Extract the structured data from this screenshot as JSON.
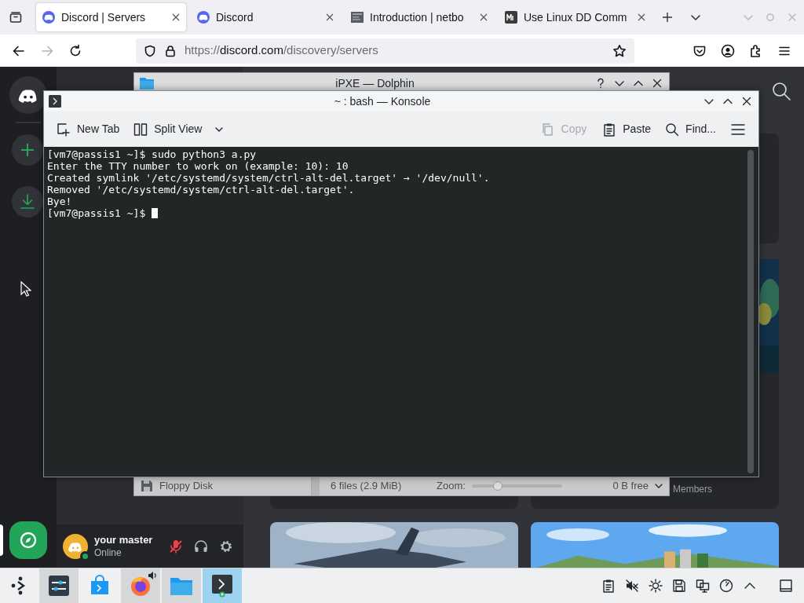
{
  "browser": {
    "tabs": [
      {
        "title": "Discord | Servers",
        "kind": "discord",
        "selected": true
      },
      {
        "title": "Discord",
        "kind": "discord",
        "selected": false
      },
      {
        "title": "Introduction | netbo",
        "kind": "page",
        "selected": false
      },
      {
        "title": "Use Linux DD Comm",
        "kind": "letter",
        "selected": false
      }
    ],
    "nav_buttons": [
      {
        "kind": "back",
        "disabled": false
      },
      {
        "kind": "forward",
        "disabled": true
      },
      {
        "kind": "reload",
        "disabled": false
      }
    ],
    "url": {
      "scheme": "https://",
      "domain": "discord.com",
      "path": "/discovery/servers"
    }
  },
  "discord": {
    "rail": [
      {
        "kind": "home",
        "selected": false
      },
      {
        "kind": "add",
        "selected": false
      },
      {
        "kind": "download",
        "selected": false
      },
      {
        "kind": "explore",
        "selected": true
      }
    ],
    "members_label": "Members",
    "user": {
      "name": "your master",
      "status": "Online",
      "mic_muted": true
    }
  },
  "dolphin": {
    "title": "iPXE — Dolphin",
    "place": "Floppy Disk",
    "file_summary": "6 files (2.9 MiB)",
    "zoom_label": "Zoom:",
    "zoom": {
      "level": 0.29
    },
    "free_space": "0 B free"
  },
  "konsole": {
    "title": "~ : bash — Konsole",
    "toolbar": [
      {
        "kind": "new-tab",
        "label": "New Tab",
        "disabled": false
      },
      {
        "kind": "split-view",
        "label": "Split View",
        "disabled": false
      },
      {
        "kind": "copy",
        "label": "Copy",
        "disabled": true
      },
      {
        "kind": "paste",
        "label": "Paste",
        "disabled": false
      },
      {
        "kind": "find",
        "label": "Find...",
        "disabled": false
      },
      {
        "kind": "menu",
        "disabled": false
      }
    ],
    "lines": [
      "[vm7@passis1 ~]$ sudo python3 a.py",
      "Enter the TTY number to work on (example: 10): 10",
      "Created symlink '/etc/systemd/system/ctrl-alt-del.target' → '/dev/null'.",
      "Removed '/etc/systemd/system/ctrl-alt-del.target'.",
      "Bye!",
      "[vm7@passis1 ~]$"
    ]
  },
  "taskbar": {
    "tasks": [
      {
        "kind": "settings",
        "open": true,
        "selected": false,
        "playing_audio": false
      },
      {
        "kind": "store",
        "open": false,
        "selected": false,
        "playing_audio": false
      },
      {
        "kind": "browser",
        "open": true,
        "selected": false,
        "playing_audio": true
      },
      {
        "kind": "files",
        "open": true,
        "selected": false,
        "playing_audio": false
      },
      {
        "kind": "terminal",
        "open": true,
        "selected": true,
        "playing_audio": false
      }
    ]
  }
}
